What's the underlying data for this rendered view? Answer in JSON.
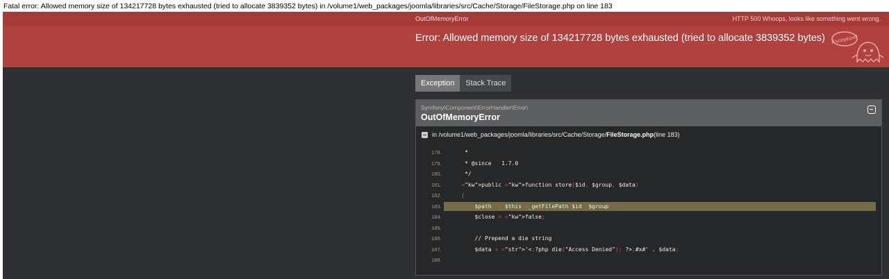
{
  "fatal": {
    "prefix": "Fatal error",
    "text": ": Allowed memory size of 134217728 bytes exhausted (tried to allocate 3839352 bytes) in ",
    "path": "/volume1/web_packages/joomla/libraries/src/Cache/Storage/FileStorage.php",
    "on_line": " on line ",
    "line": "183"
  },
  "exception": {
    "class_top": "OutOfMemoryError",
    "http_status": "HTTP 500 Whoops, looks like something went wrong.",
    "message": "Error: Allowed memory size of 134217728 bytes exhausted (tried to allocate 3839352 bytes)",
    "badge_text": "Exception!"
  },
  "tabs": [
    {
      "label": "Exception",
      "active": true
    },
    {
      "label": "Stack Trace",
      "active": false
    }
  ],
  "trace": {
    "namespace": "Symfony\\Component\\ErrorHandler\\Error\\",
    "class": "OutOfMemoryError",
    "file_prefix": "in /volume1/web_packages/joomla/libraries/src/Cache/Storage/",
    "file_name": "FileStorage.php",
    "file_suffix": " (line 183)"
  },
  "code": [
    {
      "n": "178.",
      "t": "     *"
    },
    {
      "n": "179.",
      "t": "     * @since   1.7.0"
    },
    {
      "n": "180.",
      "t": "     */"
    },
    {
      "n": "181.",
      "t": "    public function store($id, $group, $data)"
    },
    {
      "n": "182.",
      "t": "    {"
    },
    {
      "n": "183.",
      "t": "        $path  = $this->_getFilePath($id, $group);"
    },
    {
      "n": "184.",
      "t": "        $close = false;"
    },
    {
      "n": "185.",
      "t": ""
    },
    {
      "n": "186.",
      "t": "        // Prepend a die string"
    },
    {
      "n": "187.",
      "t": "        $data = '<?php die(\"Access Denied\"); ?>#x#' . $data;"
    },
    {
      "n": "188.",
      "t": ""
    }
  ],
  "highlight_line": "183.",
  "colors": {
    "bar": "#a53a37",
    "header": "#b0413e",
    "background": "#2e3033",
    "highlight": "#726b45"
  }
}
